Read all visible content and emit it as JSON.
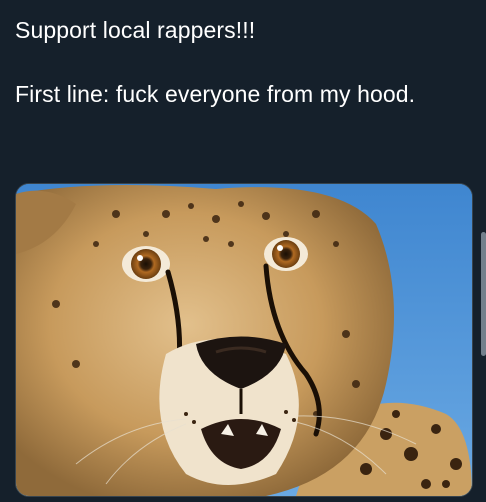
{
  "post": {
    "line1": "Support local rappers!!!",
    "line2": "First line: fuck everyone from my hood."
  },
  "media": {
    "icon": "cheetah-photo",
    "sky_color": "#4a8fd4",
    "fur_color": "#c79a5c"
  },
  "colors": {
    "background": "#15202b",
    "text": "#ffffff"
  }
}
